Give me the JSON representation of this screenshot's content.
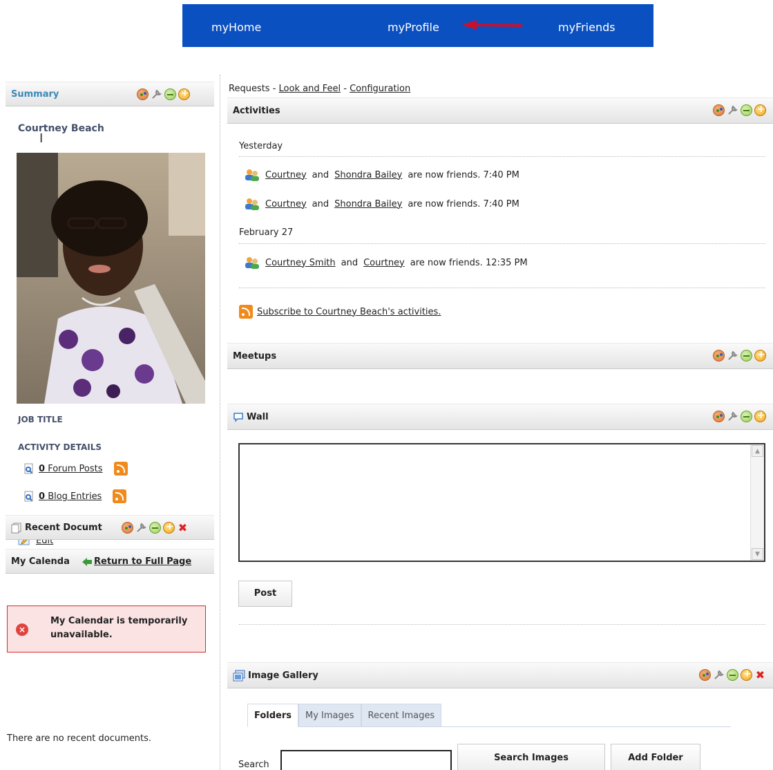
{
  "nav": {
    "items": [
      "myHome",
      "myProfile",
      "myFriends"
    ]
  },
  "summary": {
    "title": "Summary",
    "user_name": "Courtney Beach",
    "job_title_label": "JOB TITLE",
    "activity_details_label": "ACTIVITY DETAILS",
    "forum_posts_count": "0",
    "forum_posts_label": "Forum Posts",
    "blog_entries_count": "0",
    "blog_entries_label": "Blog Entries",
    "edit_label": "Edit"
  },
  "calendar": {
    "title": "My Calenda",
    "return_label": "Return to Full Page",
    "error_text": "My Calendar is temporarily unavailable."
  },
  "recent_documents": {
    "title": "Recent Docum",
    "title_tail": "t",
    "empty_text": "There are no recent documents."
  },
  "requests_bar": {
    "prefix": "Requests - ",
    "look_and_feel": "Look and Feel",
    "separator": " - ",
    "configuration": "Configuration"
  },
  "activities": {
    "title": "Activities",
    "groups": [
      {
        "date": "Yesterday",
        "items": [
          {
            "user1": "Courtney",
            "and": "and",
            "user2": "Shondra Bailey",
            "text": "are now friends. 7:40 PM"
          },
          {
            "user1": "Courtney",
            "and": "and",
            "user2": "Shondra Bailey",
            "text": "are now friends. 7:40 PM"
          }
        ]
      },
      {
        "date": "February 27",
        "items": [
          {
            "user1": "Courtney Smith",
            "and": "and",
            "user2": "Courtney",
            "text": "are now friends. 12:35 PM"
          }
        ]
      }
    ],
    "subscribe_label": "Subscribe to Courtney Beach's activities."
  },
  "meetups": {
    "title": "Meetups"
  },
  "wall": {
    "title": "Wall",
    "post_label": "Post",
    "textarea_value": ""
  },
  "image_gallery": {
    "title": "Image Gallery",
    "tabs": [
      "Folders",
      "My Images",
      "Recent Images"
    ],
    "active_tab": "Folders",
    "search_label": "Search",
    "search_value": "",
    "search_button": "Search Images",
    "add_folder_button": "Add Folder"
  },
  "colors": {
    "nav_bg": "#0a50c0",
    "summary_title": "#3b88b8",
    "error_border": "#d62b2b",
    "error_bg": "#fbe3e4",
    "rss": "#f08a1c"
  }
}
